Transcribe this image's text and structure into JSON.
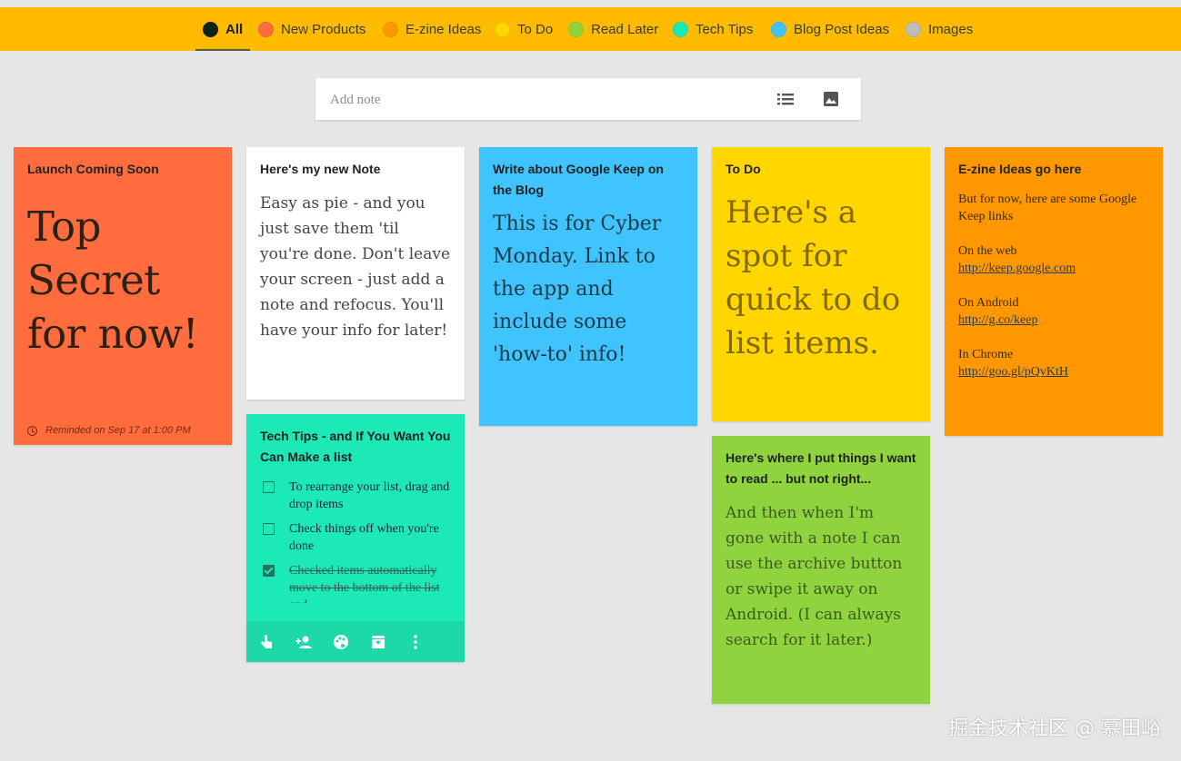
{
  "filters": [
    {
      "label": "All",
      "color": "#1a2a1a",
      "active": true
    },
    {
      "label": "New Products",
      "color": "#ff6d3f"
    },
    {
      "label": "E-zine Ideas",
      "color": "#ff9800"
    },
    {
      "label": "To Do",
      "color": "#ffd600"
    },
    {
      "label": "Read Later",
      "color": "#8fd43f"
    },
    {
      "label": "Tech Tips",
      "color": "#1de9b6"
    },
    {
      "label": "Blog Post Ideas",
      "color": "#40c4ff"
    },
    {
      "label": "Images",
      "color": "#bdbdbd"
    }
  ],
  "add_note": {
    "placeholder": "Add note",
    "list_icon": "list-icon",
    "image_icon": "image-icon"
  },
  "notes": {
    "launch": {
      "title": "Launch Coming Soon",
      "big_lines": [
        "Top",
        "Secret",
        "for now!"
      ],
      "reminder": "Reminded on Sep 17 at 1:00 PM",
      "color": "#ff6d3f"
    },
    "new_note": {
      "title": "Here's my new Note",
      "body": "Easy as pie - and you just save them 'til you're done.  Don't leave your screen - just add a note and refocus.  You'll have your info for later!",
      "color": "#ffffff"
    },
    "tech_tips": {
      "title": "Tech Tips - and If You Want You Can Make a list",
      "items": [
        {
          "text": "To rearrange your list, drag and drop items",
          "checked": false
        },
        {
          "text": "Check things off when you're done",
          "checked": false
        },
        {
          "text": "Checked items automatically move to the bottom of the list and...",
          "checked": true
        }
      ],
      "toolbar": [
        "touch-icon",
        "add-person-icon",
        "palette-icon",
        "archive-icon",
        "more-icon"
      ],
      "color": "#1de9b6"
    },
    "blog": {
      "title": "Write about Google Keep on the Blog",
      "body": "This is for Cyber Monday.  Link to the app and include some 'how-to' info!",
      "color": "#40c4ff"
    },
    "todo": {
      "title": "To Do",
      "big_lines": [
        "Here's a",
        "spot for",
        "quick to do",
        "list items."
      ],
      "color": "#ffd600"
    },
    "read_later": {
      "title": "Here's where I put things I want to read ... but not right...",
      "body": "And then when I'm gone with a note I can use the archive button or swipe it away on Android. (I can always search for it later.)",
      "color": "#8fd43f"
    },
    "ezine": {
      "title": "E-zine Ideas go here",
      "intro": "But for now, here are some Google Keep links",
      "web_label": "On the web",
      "web_link": "http://keep.google.com",
      "android_label": "On Android",
      "android_link": "http://g.co/keep",
      "chrome_label": "In Chrome",
      "chrome_link": "http://goo.gl/pQvKtH",
      "color": "#ff9800"
    }
  },
  "watermark": "掘金技术社区 @ 慕田峪"
}
